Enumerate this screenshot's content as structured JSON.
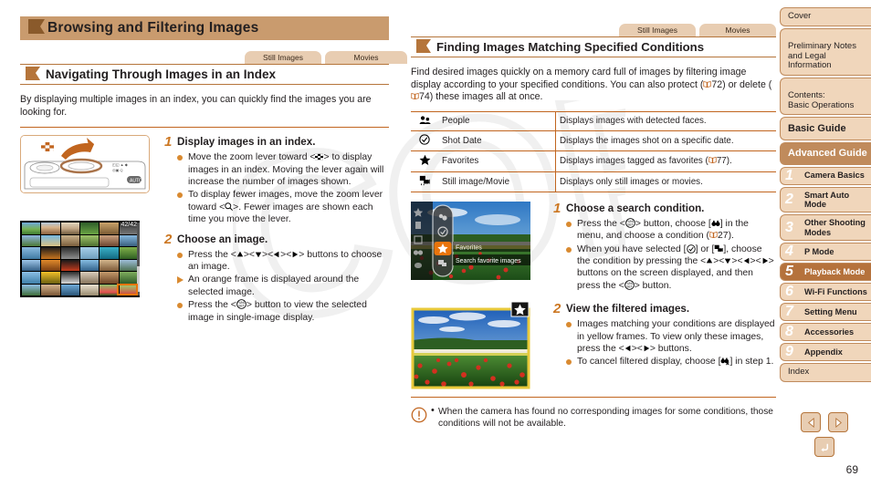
{
  "chapter": {
    "title": "Browsing and Filtering Images"
  },
  "left": {
    "tabs": [
      {
        "label": "Still Images"
      },
      {
        "label": "Movies"
      }
    ],
    "section_title": "Navigating Through Images in an Index",
    "intro": "By displaying multiple images in an index, you can quickly find the images you are looking for.",
    "figure_index": {
      "counter": "42/42"
    },
    "steps": [
      {
        "number": "1",
        "title": "Display images in an index.",
        "bullets": [
          {
            "marker": "dot",
            "text_before": "Move the zoom lever toward <",
            "icon": "index-grid-icon",
            "text_after": "> to display images in an index. Moving the lever again will increase the number of images shown."
          },
          {
            "marker": "dot",
            "text_before": "To display fewer images, move the zoom lever toward <",
            "icon": "magnify-icon",
            "text_after": ">. Fewer images are shown each time you move the lever."
          }
        ]
      },
      {
        "number": "2",
        "title": "Choose an image.",
        "bullets": [
          {
            "marker": "dot",
            "text_before": "Press the <",
            "icon": "updown-leftright-arrows-icon",
            "text_after": "> buttons to choose an image."
          },
          {
            "marker": "triangle",
            "text_before": "An orange frame is displayed around the selected image.",
            "icon": "",
            "text_after": ""
          },
          {
            "marker": "dot",
            "text_before": "Press the <",
            "icon": "func-set-button-icon",
            "text_after": "> button to view the selected image in single-image display."
          }
        ]
      }
    ]
  },
  "right": {
    "tabs": [
      {
        "label": "Still Images"
      },
      {
        "label": "Movies"
      }
    ],
    "section_title": "Finding Images Matching Specified Conditions",
    "intro_part1": "Find desired images quickly on a memory card full of images by filtering image display according to your specified conditions. You can also protect (",
    "intro_ref1": "72",
    "intro_part2": ") or delete (",
    "intro_ref2": "74",
    "intro_part3": ") these images all at once.",
    "conditions_table": {
      "rows": [
        {
          "icon": "people-icon",
          "name": "People",
          "description": "Displays images with detected faces."
        },
        {
          "icon": "shot-date-icon",
          "name": "Shot Date",
          "description": "Displays the images shot on a specific date."
        },
        {
          "icon": "star-icon",
          "name": "Favorites",
          "description_before": "Displays images tagged as favorites (",
          "description_ref": "77",
          "description_after": ")."
        },
        {
          "icon": "still-movie-icon",
          "name": "Still image/Movie",
          "description": "Displays only still images or movies."
        }
      ]
    },
    "figure_menu": {
      "label_top": "Favorites",
      "label_bottom": "Search favorite images"
    },
    "steps": [
      {
        "number": "1",
        "title": "Choose a search condition.",
        "bullets": [
          {
            "marker": "dot",
            "segments": "Press the <FUNC.SET> button, choose [binoculars] in the menu, and choose a condition (p.27)."
          },
          {
            "marker": "dot",
            "segments": "When you have selected [shot-date] or [still-movie], choose the condition by pressing the <up><down><left><right> buttons on the screen displayed, and then press the <FUNC.SET> button."
          }
        ],
        "ref": "27"
      },
      {
        "number": "2",
        "title": "View the filtered images.",
        "bullets": [
          {
            "marker": "dot",
            "segments": "Images matching your conditions are displayed in yellow frames. To view only these images, press the <left><right> buttons."
          },
          {
            "marker": "dot",
            "segments": "To cancel filtered display, choose [binoculars-cancel] in step 1."
          }
        ]
      }
    ],
    "note": "When the camera has found no corresponding images for some conditions, those conditions will not be available."
  },
  "sidebar": {
    "items": [
      {
        "label": "Cover",
        "type": "plain"
      },
      {
        "label": "Preliminary Notes and Legal Information",
        "type": "plain"
      },
      {
        "label": "Contents:\nBasic Operations",
        "type": "plain"
      },
      {
        "label": "Basic Guide",
        "type": "big"
      },
      {
        "label": "Advanced Guide",
        "type": "chapter"
      },
      {
        "number": "1",
        "label": "Camera Basics",
        "type": "numbered"
      },
      {
        "number": "2",
        "label": "Smart Auto Mode",
        "type": "numbered"
      },
      {
        "number": "3",
        "label": "Other Shooting Modes",
        "type": "numbered"
      },
      {
        "number": "4",
        "label": "P Mode",
        "type": "numbered"
      },
      {
        "number": "5",
        "label": "Playback Mode",
        "type": "numbered",
        "active": true
      },
      {
        "number": "6",
        "label": "Wi-Fi Functions",
        "type": "numbered"
      },
      {
        "number": "7",
        "label": "Setting Menu",
        "type": "numbered"
      },
      {
        "number": "8",
        "label": "Accessories",
        "type": "numbered"
      },
      {
        "number": "9",
        "label": "Appendix",
        "type": "numbered"
      },
      {
        "label": "Index",
        "type": "plain"
      }
    ]
  },
  "footer": {
    "page_number": "69",
    "prev_label": "previous-page-arrow",
    "next_label": "next-page-arrow",
    "back_label": "back-button"
  },
  "watermark": {
    "text": "COPY"
  },
  "colors": {
    "accent_orange": "#cc7722",
    "rule": "#c1651f",
    "bar": "#c99b6e",
    "tab": "#e8cdb2",
    "nav": "#f0d6bb",
    "nav_active": "#b5723c"
  }
}
